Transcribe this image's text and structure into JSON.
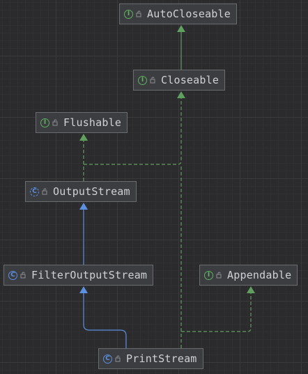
{
  "diagram": {
    "nodes": {
      "autocloseable": {
        "name": "AutoCloseable",
        "kind": "interface",
        "kind_letter": "I"
      },
      "closeable": {
        "name": "Closeable",
        "kind": "interface",
        "kind_letter": "I"
      },
      "flushable": {
        "name": "Flushable",
        "kind": "interface",
        "kind_letter": "I"
      },
      "outputstream": {
        "name": "OutputStream",
        "kind": "abstract-class",
        "kind_letter": "C"
      },
      "filteroutputstream": {
        "name": "FilterOutputStream",
        "kind": "class",
        "kind_letter": "C"
      },
      "appendable": {
        "name": "Appendable",
        "kind": "interface",
        "kind_letter": "I"
      },
      "printstream": {
        "name": "PrintStream",
        "kind": "class",
        "kind_letter": "C"
      }
    },
    "relations": [
      {
        "from": "Closeable",
        "to": "AutoCloseable",
        "type": "extends"
      },
      {
        "from": "OutputStream",
        "to": "Closeable",
        "type": "implements"
      },
      {
        "from": "OutputStream",
        "to": "Flushable",
        "type": "implements"
      },
      {
        "from": "FilterOutputStream",
        "to": "OutputStream",
        "type": "extends"
      },
      {
        "from": "PrintStream",
        "to": "FilterOutputStream",
        "type": "extends"
      },
      {
        "from": "PrintStream",
        "to": "Appendable",
        "type": "implements"
      },
      {
        "from": "PrintStream",
        "to": "Closeable",
        "type": "implements"
      }
    ],
    "colors": {
      "interface_badge": "#5fb35f",
      "class_badge": "#5b8fe0",
      "extends_line": "#5b8fe0",
      "interface_extends_line": "#5fa05f",
      "implements_line": "#5fa05f",
      "node_fill": "#3c3d40",
      "node_border": "#6b6c70",
      "text": "#cfd1d6"
    },
    "icons": [
      "interface-icon",
      "class-icon",
      "abstract-class-icon",
      "public-visibility-icon"
    ]
  }
}
